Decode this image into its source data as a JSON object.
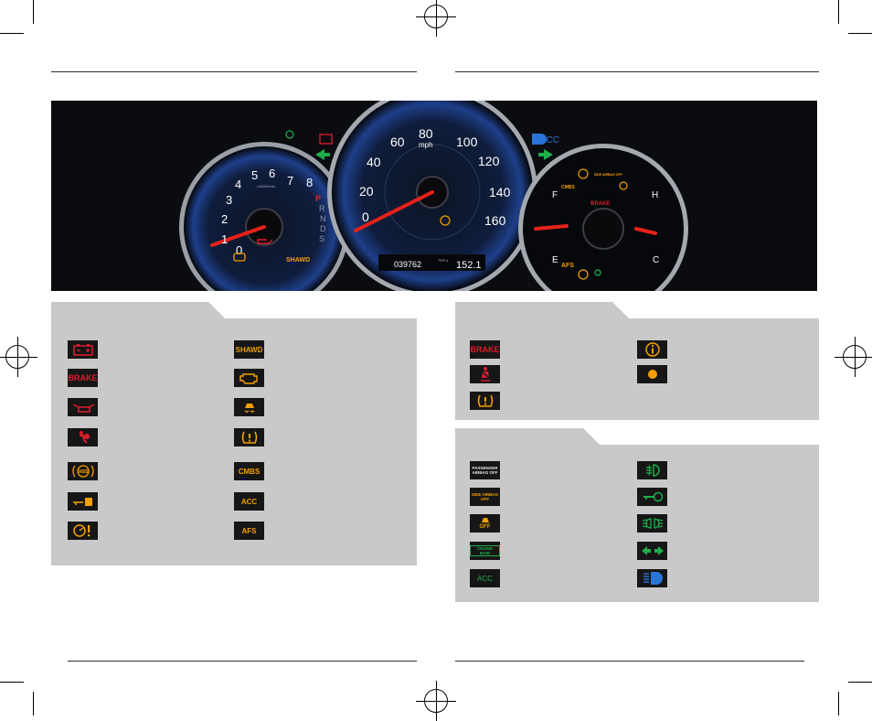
{
  "cluster": {
    "tach_numbers": [
      "0",
      "1",
      "2",
      "3",
      "4",
      "5",
      "6",
      "7",
      "8"
    ],
    "tach_unit": "x1000r/min",
    "gear_letters": [
      "P",
      "R",
      "N",
      "D",
      "S"
    ],
    "speed_numbers": [
      "0",
      "20",
      "40",
      "60",
      "80",
      "100",
      "120",
      "140",
      "160"
    ],
    "speed_unit": "mph",
    "odometer": "039762",
    "trip_prefix": "TRIP A",
    "trip": "152.1",
    "acc_label": "ACC",
    "brake_label": "BRAKE",
    "cmbs_label": "CMBS",
    "shawd_label": "SHAWD",
    "afs_label": "AFS",
    "fuel_f": "F",
    "fuel_e": "E",
    "temp_h": "H",
    "temp_c": "C",
    "side_airbag_label": "SIDE AIRBAG OFF"
  },
  "left_panel": {
    "col1": [
      {
        "icon": "battery-icon",
        "color": "#e01c2c"
      },
      {
        "icon": "brake-icon",
        "label": "BRAKE",
        "color": "#e01c2c"
      },
      {
        "icon": "oil-pressure-icon",
        "color": "#e01c2c"
      },
      {
        "icon": "airbag-icon",
        "color": "#e01c2c"
      },
      {
        "icon": "abs-icon",
        "label": "ABS",
        "color": "#f5a000"
      },
      {
        "icon": "immobilizer-icon",
        "color": "#f5a000"
      },
      {
        "icon": "steering-warning-icon",
        "color": "#f5a000"
      }
    ],
    "col2": [
      {
        "icon": "shawd-icon",
        "label": "SHAWD",
        "color": "#f5a000"
      },
      {
        "icon": "check-engine-icon",
        "color": "#f5a000"
      },
      {
        "icon": "vsa-icon",
        "color": "#f5a000"
      },
      {
        "icon": "tpms-icon",
        "color": "#f5a000"
      },
      {
        "icon": "cmbs-icon",
        "label": "CMBS",
        "color": "#f5a000"
      },
      {
        "icon": "acc-icon",
        "label": "ACC",
        "color": "#f5a000"
      },
      {
        "icon": "afs-icon",
        "label": "AFS",
        "color": "#f5a000"
      }
    ]
  },
  "right_top": {
    "col1": [
      {
        "icon": "brake-icon",
        "label": "BRAKE",
        "color": "#e01c2c"
      },
      {
        "icon": "seatbelt-icon",
        "color": "#e01c2c"
      },
      {
        "icon": "tpms-icon",
        "color": "#f5a000"
      }
    ],
    "col2": [
      {
        "icon": "info-icon",
        "color": "#f5a000"
      },
      {
        "icon": "amber-dot-icon",
        "color": "#f5a000"
      }
    ]
  },
  "right_bottom": {
    "col1": [
      {
        "icon": "passenger-airbag-off-icon",
        "label": "PASSENGER AIRBAG OFF",
        "color": "#e8e8e8"
      },
      {
        "icon": "side-airbag-off-icon",
        "label": "SIDE AIRBAG OFF",
        "color": "#f5a000"
      },
      {
        "icon": "vsa-off-icon",
        "label": "OFF",
        "color": "#f5a000"
      },
      {
        "icon": "cruise-main-icon",
        "label": "CRUISE MAIN",
        "color": "#1fae4a"
      },
      {
        "icon": "acc-icon",
        "label": "ACC",
        "color": "#1fae4a"
      }
    ],
    "col2": [
      {
        "icon": "fog-light-icon",
        "color": "#1fae4a"
      },
      {
        "icon": "key-icon",
        "color": "#1fae4a"
      },
      {
        "icon": "parking-light-icon",
        "color": "#1fae4a"
      },
      {
        "icon": "turn-signal-icon",
        "color": "#1fae4a"
      },
      {
        "icon": "high-beam-icon",
        "color": "#2a74d8"
      }
    ]
  }
}
